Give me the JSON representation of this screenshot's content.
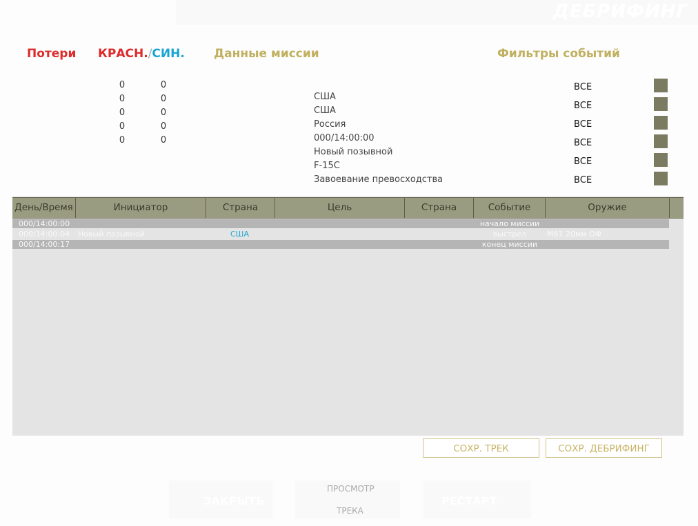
{
  "header": {
    "title": "ДЕБРИФИНГ"
  },
  "sections": {
    "losses": "Потери",
    "red": "КРАСН.",
    "slash": "/",
    "blue": "СИН.",
    "mission": "Данные миссии",
    "filters": "Фильтры событий"
  },
  "losses": {
    "red": [
      "0",
      "0",
      "0",
      "0",
      "0"
    ],
    "blue": [
      "0",
      "0",
      "0",
      "0",
      "0"
    ]
  },
  "mission": {
    "values": [
      "США",
      "США",
      "Россия",
      "000/14:00:00",
      "Новый позывной",
      "F-15C",
      "Завоевание превосходства"
    ]
  },
  "filters": {
    "values": [
      "ВСЕ",
      "ВСЕ",
      "ВСЕ",
      "ВСЕ",
      "ВСЕ",
      "ВСЕ"
    ]
  },
  "table": {
    "columns": [
      "День/Время",
      "Инициатор",
      "Страна",
      "Цель",
      "Страна",
      "Событие",
      "Оружие"
    ],
    "rows": [
      {
        "time": "000/14:00:00",
        "initiator": "",
        "country": "",
        "target": "",
        "country2": "",
        "event": "начало миссии",
        "weapon": ""
      },
      {
        "time": "000/14:00:04",
        "initiator": "Новый позывной",
        "country": "США",
        "target": "",
        "country2": "",
        "event": "выстрел",
        "weapon": "M61 20мм ОФ"
      },
      {
        "time": "000/14:00:17",
        "initiator": "",
        "country": "",
        "target": "",
        "country2": "",
        "event": "конец миссии",
        "weapon": ""
      }
    ]
  },
  "buttons": {
    "save_track": "СОХР. ТРЕК",
    "save_debrief": "СОХР. ДЕБРИФИНГ",
    "close": "ЗАКРЫТЬ",
    "view_track_1": "ПРОСМОТР",
    "view_track_2": "ТРЕКА",
    "restart": "РЕСТАРТ"
  },
  "colors": {
    "red": "#dd2a2a",
    "blue": "#1aa5d4",
    "gold": "#c0b060",
    "header": "#9a9c82"
  }
}
